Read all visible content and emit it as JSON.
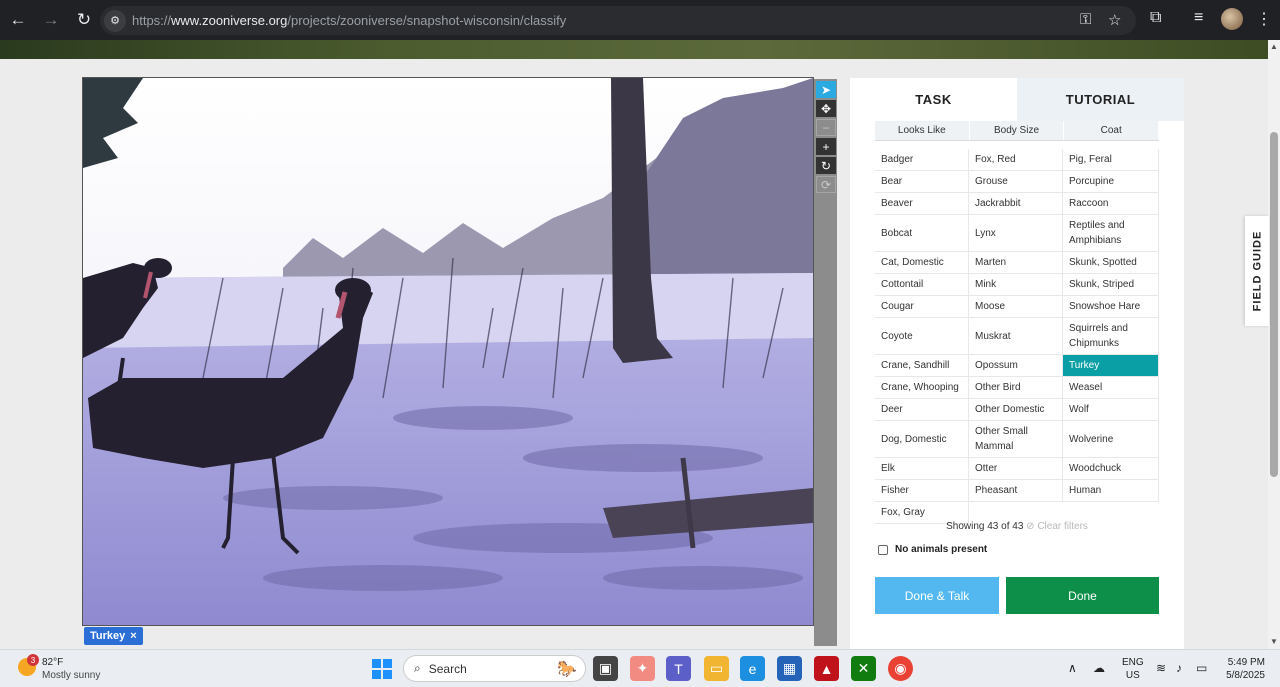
{
  "browser": {
    "url_prefix": "https://",
    "url_domain": "www.zooniverse.org",
    "url_path": "/projects/zooniverse/snapshot-wisconsin/classify"
  },
  "panel": {
    "tabs": [
      "TASK",
      "TUTORIAL"
    ],
    "filters": [
      "Looks Like",
      "Body Size",
      "Coat"
    ],
    "choices": [
      [
        "Badger",
        "Fox, Red",
        "Pig, Feral"
      ],
      [
        "Bear",
        "Grouse",
        "Porcupine"
      ],
      [
        "Beaver",
        "Jackrabbit",
        "Raccoon"
      ],
      [
        "Bobcat",
        "Lynx",
        "Reptiles and Amphibians"
      ],
      [
        "Cat, Domestic",
        "Marten",
        "Skunk, Spotted"
      ],
      [
        "Cottontail",
        "Mink",
        "Skunk, Striped"
      ],
      [
        "Cougar",
        "Moose",
        "Snowshoe Hare"
      ],
      [
        "Coyote",
        "Muskrat",
        "Squirrels and Chipmunks"
      ],
      [
        "Crane, Sandhill",
        "Opossum",
        "Turkey"
      ],
      [
        "Crane, Whooping",
        "Other Bird",
        "Weasel"
      ],
      [
        "Deer",
        "Other Domestic",
        "Wolf"
      ],
      [
        "Dog, Domestic",
        "Other Small Mammal",
        "Wolverine"
      ],
      [
        "Elk",
        "Otter",
        "Woodchuck"
      ],
      [
        "Fisher",
        "Pheasant",
        "Human"
      ],
      [
        "Fox, Gray",
        "",
        ""
      ]
    ],
    "selected_choice": "Turkey",
    "showing": "Showing 43 of 43",
    "clear_filters": "Clear filters",
    "no_animals": "No animals present",
    "done_talk": "Done & Talk",
    "done": "Done"
  },
  "subject": {
    "tag": "Turkey",
    "tag_close": "×"
  },
  "field_guide": "FIELD GUIDE",
  "taskbar": {
    "weather_badge": "3",
    "temperature": "82°F",
    "condition": "Mostly sunny",
    "search": "Search",
    "lang_line1": "ENG",
    "lang_line2": "US",
    "time": "5:49 PM",
    "date": "5/8/2025"
  },
  "colors": {
    "selected": "#0a9fa4",
    "done": "#0d8f4a",
    "done_talk": "#54b8f0",
    "tool_active": "#2ba9e1"
  }
}
